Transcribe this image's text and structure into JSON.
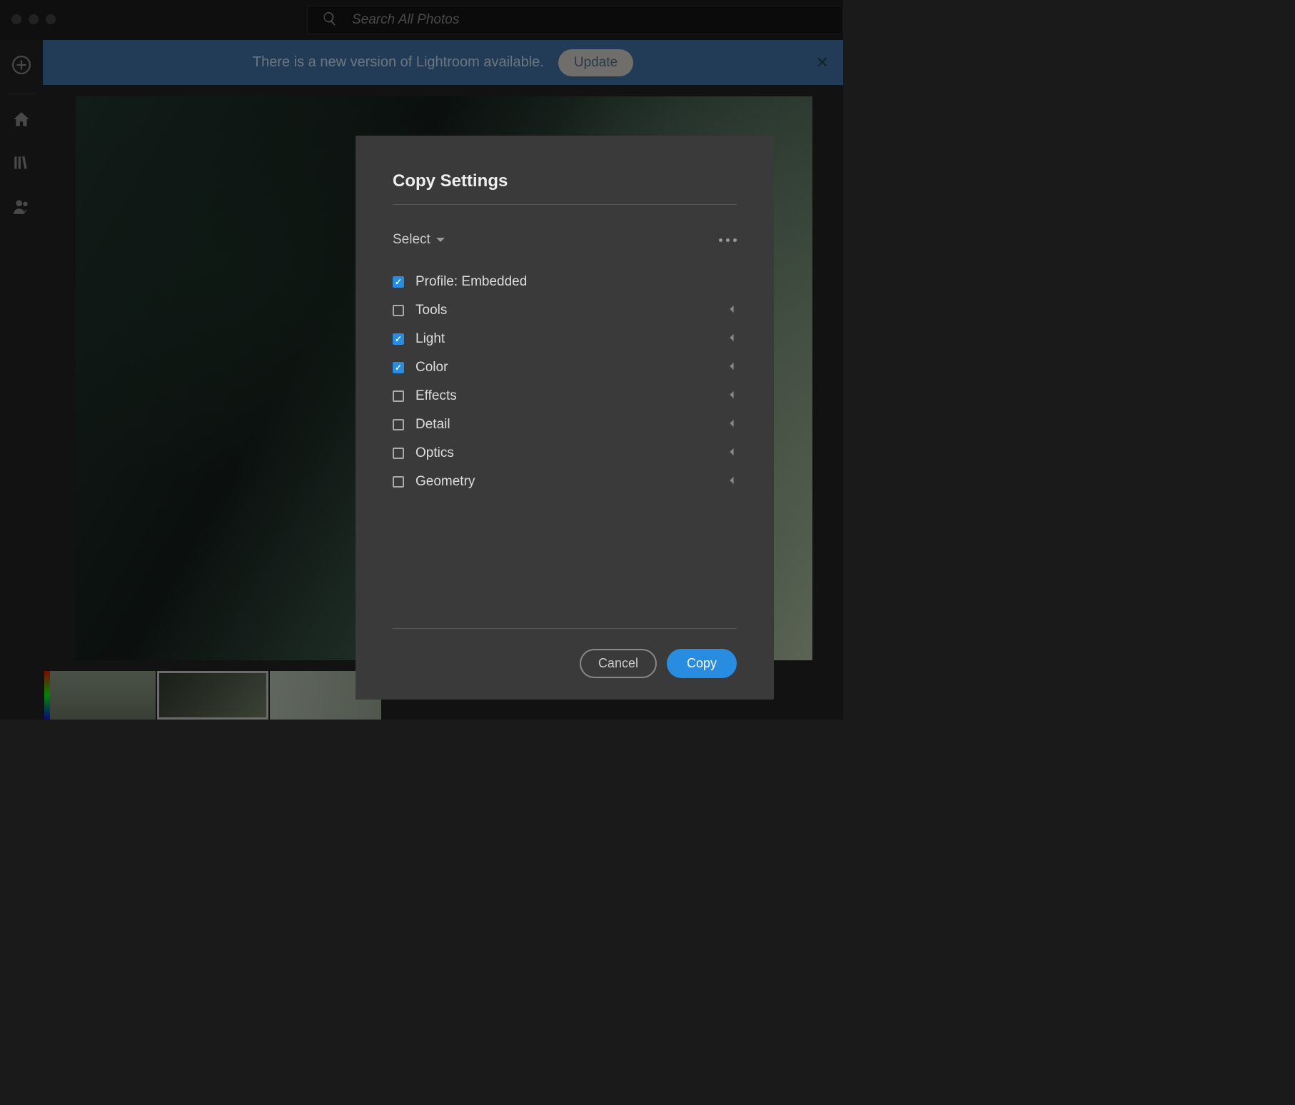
{
  "search": {
    "placeholder": "Search All Photos"
  },
  "banner": {
    "message": "There is a new version of Lightroom available.",
    "update_label": "Update"
  },
  "dialog": {
    "title": "Copy Settings",
    "select_label": "Select",
    "settings": [
      {
        "label": "Profile: Embedded",
        "checked": true,
        "expandable": false
      },
      {
        "label": "Tools",
        "checked": false,
        "expandable": true
      },
      {
        "label": "Light",
        "checked": true,
        "expandable": true
      },
      {
        "label": "Color",
        "checked": true,
        "expandable": true
      },
      {
        "label": "Effects",
        "checked": false,
        "expandable": true
      },
      {
        "label": "Detail",
        "checked": false,
        "expandable": true
      },
      {
        "label": "Optics",
        "checked": false,
        "expandable": true
      },
      {
        "label": "Geometry",
        "checked": false,
        "expandable": true
      }
    ],
    "cancel_label": "Cancel",
    "copy_label": "Copy"
  },
  "left_rail_icons": [
    "add",
    "home",
    "library",
    "sharing"
  ],
  "colors": {
    "accent_blue": "#288de0",
    "banner_blue": "#3b6ea5"
  }
}
